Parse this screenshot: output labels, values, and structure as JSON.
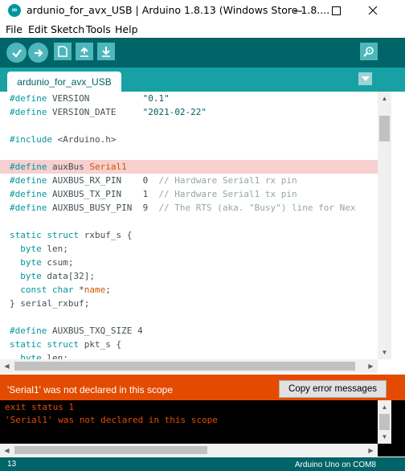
{
  "window": {
    "title": "ardunio_for_avx_USB | Arduino 1.8.13 (Windows Store 1.8....",
    "app_icon": "arduino-logo-icon",
    "controls": [
      "minimize-icon",
      "maximize-icon",
      "close-icon"
    ]
  },
  "menu": {
    "items": [
      {
        "label": "File"
      },
      {
        "label": "Edit"
      },
      {
        "label": "Sketch"
      },
      {
        "label": "Tools"
      },
      {
        "label": "Help"
      }
    ]
  },
  "toolbar": {
    "buttons": [
      {
        "name": "verify",
        "icon": "checkmark-icon"
      },
      {
        "name": "upload",
        "icon": "right-arrow-icon"
      },
      {
        "name": "new",
        "icon": "new-file-icon"
      },
      {
        "name": "open",
        "icon": "up-arrow-icon"
      },
      {
        "name": "save",
        "icon": "down-arrow-icon"
      },
      {
        "name": "serial-monitor",
        "icon": "magnifier-icon"
      }
    ]
  },
  "tabs": {
    "active": "ardunio_for_avx_USB",
    "menu_icon": "triangle-down-icon"
  },
  "code": {
    "lines": [
      "#define VERSION          \"0.1\"",
      "#define VERSION_DATE     \"2021-02-22\"",
      "",
      "#include <Arduino.h>",
      "",
      "#define auxBus Serial1",
      "#define AUXBUS_RX_PIN    0  // Hardware Serial1 rx pin",
      "#define AUXBUS_TX_PIN    1  // Hardware Serial1 tx pin",
      "#define AUXBUS_BUSY_PIN  9  // The RTS (aka. \"Busy\") line for Nex",
      "",
      "static struct rxbuf_s {",
      "  byte len;",
      "  byte csum;",
      "  byte data[32];",
      "  const char *name;",
      "} serial_rxbuf;",
      "",
      "#define AUXBUS_TXQ_SIZE 4",
      "static struct pkt_s {",
      "  byte len;"
    ],
    "highlighted_line_index": 5
  },
  "error_bar": {
    "message": "'Serial1' was not declared in this scope",
    "copy_button": "Copy error messages"
  },
  "console": {
    "lines": [
      "exit status 1",
      "'Serial1' was not declared in this scope"
    ]
  },
  "status": {
    "line_number": "13",
    "board": "Arduino Uno on COM8"
  },
  "colors": {
    "toolbar_bg": "#006468",
    "tabbar_bg": "#17a1a5",
    "button_bg": "#4db7bb",
    "error_bg": "#e34c00",
    "highlight": "#f7cfcf",
    "console_text": "#e34c00"
  }
}
